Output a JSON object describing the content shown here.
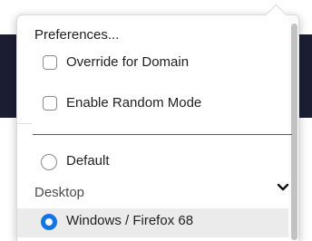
{
  "menu": {
    "preferences_label": "Preferences...",
    "override_for_domain": {
      "label": "Override for Domain",
      "checked": false
    },
    "enable_random_mode": {
      "label": "Enable Random Mode",
      "checked": false
    },
    "default_option": {
      "label": "Default",
      "selected": false
    },
    "group_label": "Desktop",
    "group_chevron": "chevron-down-icon",
    "selected_option": {
      "label": "Windows / Firefox 68",
      "selected": true
    }
  },
  "colors": {
    "accent": "#1473e6",
    "background_dark": "#1b1e33",
    "selected_row": "#ebebeb"
  }
}
